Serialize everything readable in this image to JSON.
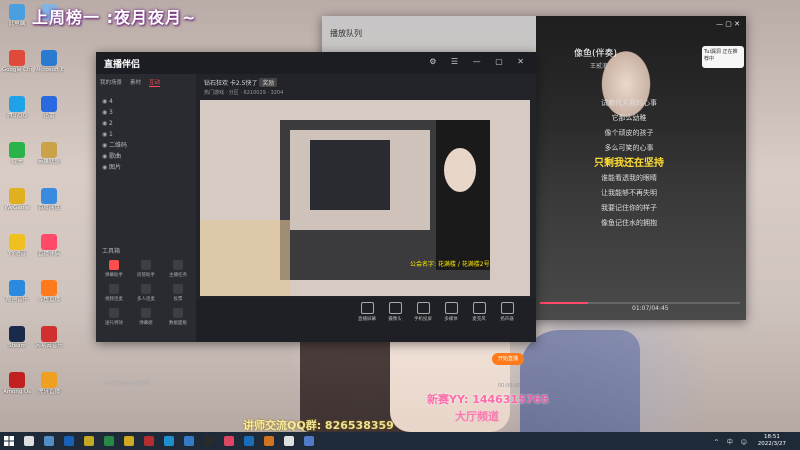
{
  "overlay": {
    "top_banner": "上周榜一 :夜月夜月~",
    "guild_line": "公会名字: 花满楼 / 花满楼2号",
    "qq_line": "讲师交流QQ群: 826538359",
    "yy_line": "新赛YY: 1446315765",
    "yy_line2": "大厅频道"
  },
  "desktop_icons": [
    {
      "label": "此电脑",
      "color": "#4a9fe0"
    },
    {
      "label": "回收站",
      "color": "#7fb4e4"
    },
    {
      "label": "Google Chrome",
      "color": "#e04a3a"
    },
    {
      "label": "Microsoft Edge",
      "color": "#2a7ad0"
    },
    {
      "label": "腾讯QQ",
      "color": "#1fa2e8"
    },
    {
      "label": "迅雷",
      "color": "#2a6ae0"
    },
    {
      "label": "微信",
      "color": "#2ab34a"
    },
    {
      "label": "英雄联盟",
      "color": "#c9a24a"
    },
    {
      "label": "WeGame",
      "color": "#e0b020"
    },
    {
      "label": "百度网盘",
      "color": "#3a8ae0"
    },
    {
      "label": "YY语音",
      "color": "#f0c020"
    },
    {
      "label": "直播伴侣",
      "color": "#ff4a6a"
    },
    {
      "label": "酷狗音乐",
      "color": "#2a8ae0"
    },
    {
      "label": "斗鱼直播",
      "color": "#ff7a1a"
    },
    {
      "label": "Steam",
      "color": "#1a2a4a"
    },
    {
      "label": "网易云音乐",
      "color": "#d03030"
    },
    {
      "label": "Among Us",
      "color": "#c02020"
    },
    {
      "label": "虎牙直播",
      "color": "#f0a020"
    }
  ],
  "music": {
    "panel_title": "播放队列",
    "song_title": "像鱼(伴奏)",
    "song_artist": "王贰浪",
    "lyrics": [
      "试着代入我的心事",
      "它那么幼稚",
      "像个顽皮的孩子",
      "多么可笑的心事",
      "只剩我还在坚持",
      "谁能看透我的眼睛",
      "让我能够不再失明",
      "我要记住你的样子",
      "像鱼记住水的拥抱"
    ],
    "active_lyric_index": 4,
    "time": "01:07/04:45",
    "progress": 0.24,
    "mini_card": "Tui漏洞 正在推荐中"
  },
  "obs": {
    "app_name": "直播伴侣",
    "tabs": [
      "我的场景",
      "素材",
      "互动"
    ],
    "active_tab": 2,
    "scenes": [
      "4",
      "3",
      "2",
      "1",
      "二维码",
      "歌曲",
      "图片"
    ],
    "stream_title": "钻石狂欢 卡2.5快了",
    "stream_tag": "奖励",
    "meta": "热门游戏 · 分区 · 6210029 · 3204",
    "tool_label": "工具箱",
    "tools": [
      "弹幕助手",
      "房管助手",
      "主播任务",
      "视频连麦",
      "多人连麦",
      "投票",
      "送礼特效",
      "弹幕姬",
      "数据面板"
    ],
    "bottom_buttons": [
      "直播屏幕",
      "摄像头",
      "手机投屏",
      "多媒体",
      "麦克风",
      "扬声器"
    ],
    "start_live": "开始直播",
    "live_time": "00:00:00",
    "bottom_note": "当前直播间外部数据"
  },
  "taskbar": {
    "time": "18:51",
    "date": "2022/3/27",
    "tray": "^ 中 ☺"
  }
}
